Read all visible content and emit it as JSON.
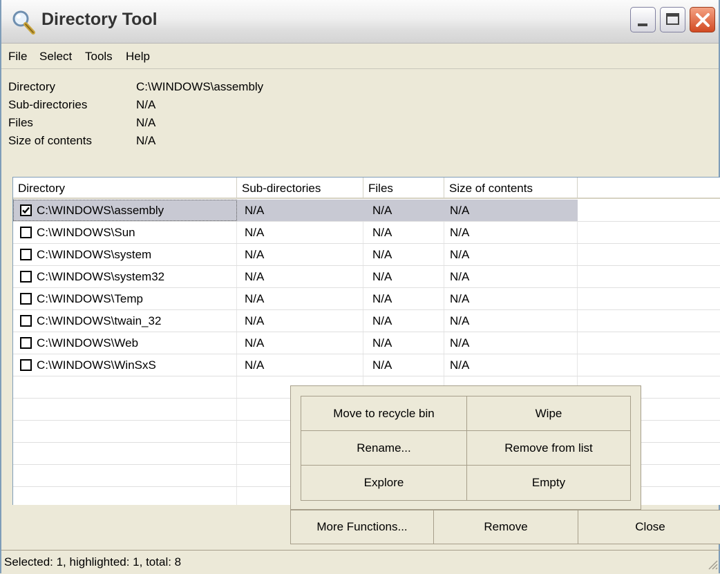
{
  "window": {
    "title": "Directory Tool",
    "close_color": "#d24a23"
  },
  "menu": [
    "File",
    "Select",
    "Tools",
    "Help"
  ],
  "info": [
    {
      "label": "Directory",
      "value": "C:\\WINDOWS\\assembly"
    },
    {
      "label": "Sub-directories",
      "value": "N/A"
    },
    {
      "label": "Files",
      "value": "N/A"
    },
    {
      "label": "Size of contents",
      "value": "N/A"
    }
  ],
  "list": {
    "columns": [
      "Directory",
      "Sub-directories",
      "Files",
      "Size of contents"
    ],
    "rows": [
      {
        "directory": "C:\\WINDOWS\\assembly",
        "subdirs": "N/A",
        "files": "N/A",
        "size": "N/A",
        "checked": true
      },
      {
        "directory": "C:\\WINDOWS\\Sun",
        "subdirs": "N/A",
        "files": "N/A",
        "size": "N/A",
        "checked": false
      },
      {
        "directory": "C:\\WINDOWS\\system",
        "subdirs": "N/A",
        "files": "N/A",
        "size": "N/A",
        "checked": false
      },
      {
        "directory": "C:\\WINDOWS\\system32",
        "subdirs": "N/A",
        "files": "N/A",
        "size": "N/A",
        "checked": false
      },
      {
        "directory": "C:\\WINDOWS\\Temp",
        "subdirs": "N/A",
        "files": "N/A",
        "size": "N/A",
        "checked": false
      },
      {
        "directory": "C:\\WINDOWS\\twain_32",
        "subdirs": "N/A",
        "files": "N/A",
        "size": "N/A",
        "checked": false
      },
      {
        "directory": "C:\\WINDOWS\\Web",
        "subdirs": "N/A",
        "files": "N/A",
        "size": "N/A",
        "checked": false
      },
      {
        "directory": "C:\\WINDOWS\\WinSxS",
        "subdirs": "N/A",
        "files": "N/A",
        "size": "N/A",
        "checked": false
      }
    ]
  },
  "functions": {
    "move_to_recycle_bin": "Move to recycle bin",
    "wipe": "Wipe",
    "rename": "Rename...",
    "remove_from_list": "Remove from list",
    "explore": "Explore",
    "empty": "Empty"
  },
  "buttons": {
    "more_functions": "More Functions...",
    "remove": "Remove",
    "close": "Close"
  },
  "status": "Selected: 1, highlighted: 1, total: 8"
}
